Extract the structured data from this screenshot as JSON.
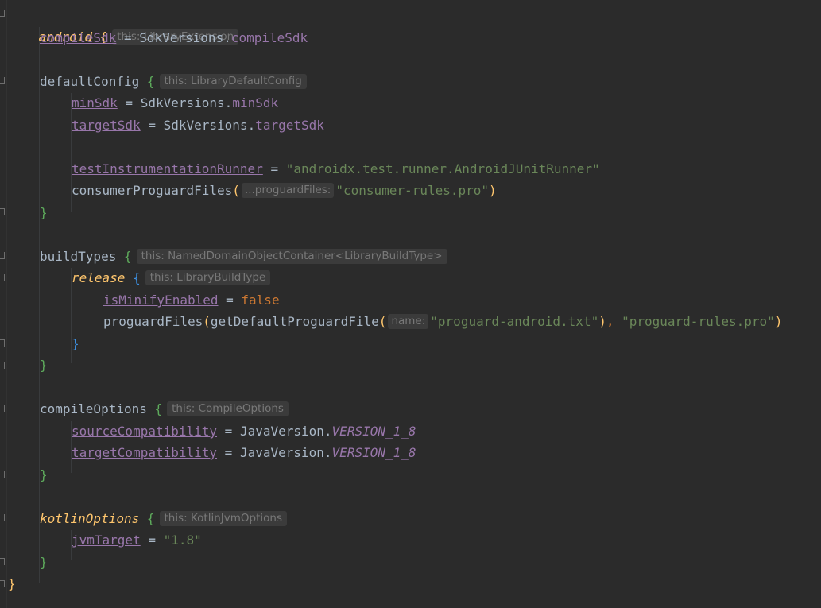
{
  "code": {
    "android": "android",
    "open_brace": "{",
    "close_brace": "}",
    "hint_android": "this: LibraryExtension",
    "compileSdk": "compileSdk",
    "eq": " = ",
    "sdk_versions": "SdkVersions",
    "dot": ".",
    "defaultConfig": "defaultConfig",
    "hint_default": "this: LibraryDefaultConfig",
    "minSdk": "minSdk",
    "targetSdk": "targetSdk",
    "testRunner": "testInstrumentationRunner",
    "testRunnerValue": "\"androidx.test.runner.AndroidJUnitRunner\"",
    "consumerProguardFiles": "consumerProguardFiles",
    "lparen": "(",
    "rparen": ")",
    "hint_proguard": "...proguardFiles:",
    "consumerRules": "\"consumer-rules.pro\"",
    "buildTypes": "buildTypes",
    "hint_buildtypes": "this: NamedDomainObjectContainer<LibraryBuildType>",
    "release": "release",
    "hint_release": "this: LibraryBuildType",
    "isMinifyEnabled": "isMinifyEnabled",
    "false": "false",
    "proguardFiles": "proguardFiles",
    "getDefault": "getDefaultProguardFile",
    "hint_name": "name:",
    "proguardAndroid": "\"proguard-android.txt\"",
    "comma": ", ",
    "proguardRules": "\"proguard-rules.pro\"",
    "compileOptions": "compileOptions",
    "hint_compileopts": "this: CompileOptions",
    "sourceCompat": "sourceCompatibility",
    "targetCompat": "targetCompatibility",
    "javaVersion": "JavaVersion",
    "version18": "VERSION_1_8",
    "kotlinOptions": "kotlinOptions",
    "hint_kotlin": "this: KotlinJvmOptions",
    "jvmTarget": "jvmTarget",
    "jvmValue": "\"1.8\""
  }
}
